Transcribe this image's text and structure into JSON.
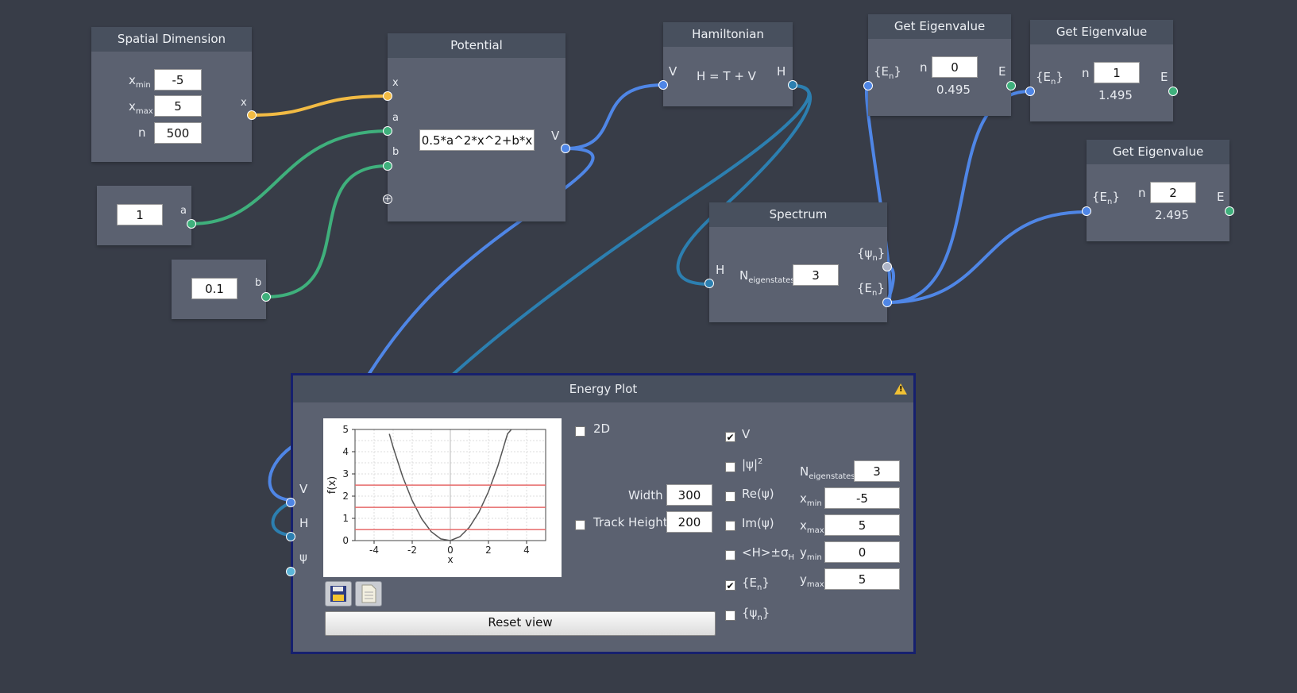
{
  "nodes": {
    "spatial": {
      "title": "Spatial Dimension",
      "xmin_label": "x",
      "xmin_sub": "min",
      "xmin_value": "-5",
      "xmax_label": "x",
      "xmax_sub": "max",
      "xmax_value": "5",
      "n_label": "n",
      "n_value": "500",
      "out_label": "x"
    },
    "const_a": {
      "value": "1",
      "out_label": "a"
    },
    "const_b": {
      "value": "0.1",
      "out_label": "b"
    },
    "potential": {
      "title": "Potential",
      "in_x": "x",
      "in_a": "a",
      "in_b": "b",
      "expression": "0.5*a^2*x^2+b*x",
      "out_label": "V"
    },
    "hamiltonian": {
      "title": "Hamiltonian",
      "in_label": "V",
      "formula": "H = T + V",
      "out_label": "H"
    },
    "spectrum": {
      "title": "Spectrum",
      "in_label": "H",
      "n_label": "N",
      "n_sub": "eigenstates",
      "n_value": "3",
      "out_psi": "{ψ",
      "out_psi_sub": "n",
      "out_psi_end": "}",
      "out_e": "{E",
      "out_e_sub": "n",
      "out_e_end": "}"
    },
    "eig0": {
      "title": "Get Eigenvalue",
      "in_label": "{E",
      "in_sub": "n",
      "in_end": "}",
      "n_label": "n",
      "n_value": "0",
      "result": "0.495",
      "out_label": "E"
    },
    "eig1": {
      "title": "Get Eigenvalue",
      "in_label": "{E",
      "in_sub": "n",
      "in_end": "}",
      "n_label": "n",
      "n_value": "1",
      "result": "1.495",
      "out_label": "E"
    },
    "eig2": {
      "title": "Get Eigenvalue",
      "in_label": "{E",
      "in_sub": "n",
      "in_end": "}",
      "n_label": "n",
      "n_value": "2",
      "result": "2.495",
      "out_label": "E"
    },
    "energy_plot": {
      "title": "Energy Plot",
      "in_v": "V",
      "in_h": "H",
      "in_psi": "ψ",
      "cb_2d": "2D",
      "width_label": "Width",
      "width_value": "300",
      "track_height_label": "Track Height",
      "height_value": "200",
      "cb_v": "V",
      "cb_psi2": "|ψ|",
      "cb_psi2_sup": "2",
      "cb_re": "Re(ψ)",
      "cb_im": "Im(ψ)",
      "cb_hsigma": "<H>±σ",
      "cb_hsigma_sub": "H",
      "cb_en": "{E",
      "cb_en_sub": "n",
      "cb_en_end": "}",
      "cb_psin": "{ψ",
      "cb_psin_sub": "n",
      "cb_psin_end": "}",
      "neig_label": "N",
      "neig_sub": "eigenstates",
      "neig_value": "3",
      "xmin_label": "x",
      "xmin_sub": "min",
      "xmin_value": "-5",
      "xmax_label": "x",
      "xmax_sub": "max",
      "xmax_value": "5",
      "ymin_label": "y",
      "ymin_sub": "min",
      "ymin_value": "0",
      "ymax_label": "y",
      "ymax_sub": "max",
      "ymax_value": "5",
      "reset_label": "Reset view",
      "checked": {
        "v": true,
        "en": true,
        "d2": false,
        "track": false,
        "psi2": false,
        "re": false,
        "im": false,
        "hs": false,
        "psin": false
      }
    }
  },
  "chart_data": {
    "type": "line",
    "xlabel": "x",
    "ylabel": "f(x)",
    "xlim": [
      -5,
      5
    ],
    "ylim": [
      0,
      5
    ],
    "xticks": [
      "-4",
      "-2",
      "0",
      "2",
      "4"
    ],
    "yticks": [
      "0",
      "1",
      "2",
      "3",
      "4",
      "5"
    ],
    "grid": true,
    "series": [
      {
        "x": [
          -3.2,
          -3.0,
          -2.5,
          -2.0,
          -1.5,
          -1.0,
          -0.5,
          0.0,
          0.5,
          1.0,
          1.5,
          2.0,
          2.5,
          3.0,
          3.2
        ],
        "values": [
          4.8,
          4.2,
          2.875,
          1.8,
          0.975,
          0.4,
          0.075,
          0.0,
          0.175,
          0.6,
          1.275,
          2.2,
          3.375,
          4.8,
          5.0
        ]
      },
      {
        "hline": 0.495
      },
      {
        "hline": 1.495
      },
      {
        "hline": 2.495
      }
    ]
  },
  "colors": {
    "background": "#383d48",
    "node": "#5b6170",
    "header": "#48505e",
    "wire_yellow": "#f2bb44",
    "wire_green": "#3fb07c",
    "wire_blue": "#4f86e6",
    "wire_dark_blue": "#2c7fb0",
    "plot_border": "#16206e",
    "energy_line": "#e66a6a"
  }
}
